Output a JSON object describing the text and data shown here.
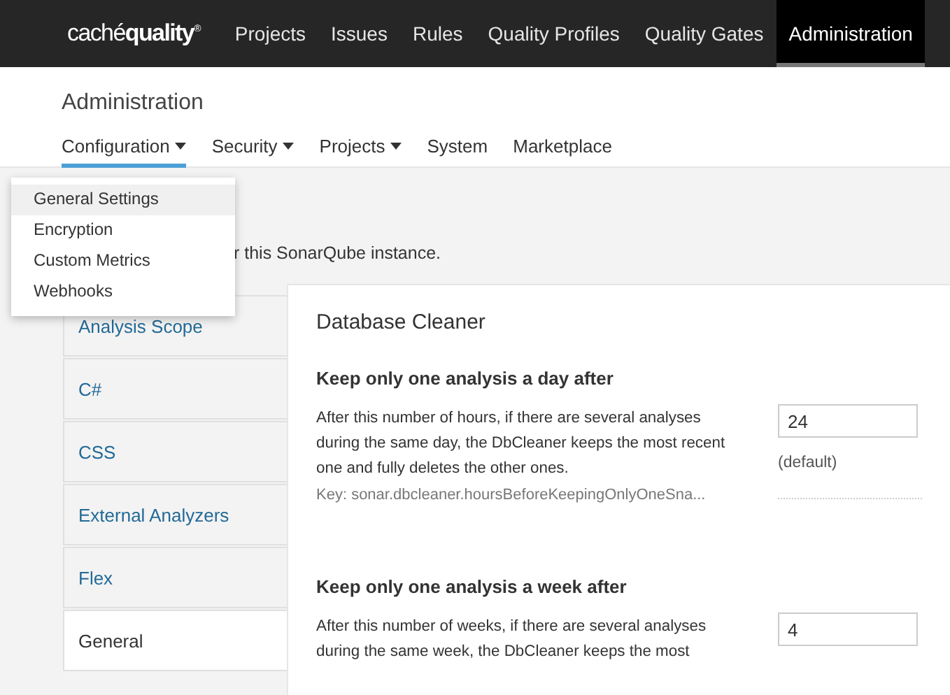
{
  "logo": "caché**quality**$^{®}$",
  "top_nav": [
    {
      "label": "Projects",
      "selected": false
    },
    {
      "label": "Issues",
      "selected": false
    },
    {
      "label": "Rules",
      "selected": false
    },
    {
      "label": "Quality Profiles",
      "selected": false
    },
    {
      "label": "Quality Gates",
      "selected": false
    },
    {
      "label": "Administration",
      "selected": true
    }
  ],
  "page_title": "Administration",
  "sub_nav": [
    {
      "label": "Configuration",
      "has_menu": true,
      "selected": true
    },
    {
      "label": "Security",
      "has_menu": true,
      "selected": false
    },
    {
      "label": "Projects",
      "has_menu": true,
      "selected": false
    },
    {
      "label": "System",
      "has_menu": false,
      "selected": false
    },
    {
      "label": "Marketplace",
      "has_menu": false,
      "selected": false
    }
  ],
  "dropdown": [
    {
      "label": "General Settings",
      "selected": true
    },
    {
      "label": "Encryption",
      "selected": false
    },
    {
      "label": "Custom Metrics",
      "selected": false
    },
    {
      "label": "Webhooks",
      "selected": false
    }
  ],
  "description": "r this SonarQube instance.",
  "categories": [
    {
      "label": "Analysis Scope",
      "selected": false
    },
    {
      "label": "C#",
      "selected": false
    },
    {
      "label": "CSS",
      "selected": false
    },
    {
      "label": "External Analyzers",
      "selected": false
    },
    {
      "label": "Flex",
      "selected": false
    },
    {
      "label": "General",
      "selected": true
    }
  ],
  "section_title": "Database Cleaner",
  "settings": [
    {
      "title": "Keep only one analysis a day after",
      "description": "After this number of hours, if there are several analyses during the same day, the DbCleaner keeps the most recent one and fully deletes the other ones.",
      "key": "Key: sonar.dbcleaner.hoursBeforeKeepingOnlyOneSna...",
      "value": "24",
      "note": "(default)"
    },
    {
      "title": "Keep only one analysis a week after",
      "description": "After this number of weeks, if there are several analyses during the same week, the DbCleaner keeps the most",
      "value": "4"
    }
  ]
}
